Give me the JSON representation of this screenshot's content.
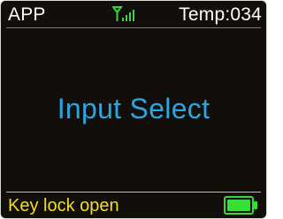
{
  "status_bar": {
    "app_label": "APP",
    "signal_icon": "signal-antenna-icon",
    "temperature_label": "Temp:034"
  },
  "main": {
    "title": "Input Select"
  },
  "footer": {
    "status_text": "Key lock open",
    "battery_icon": "battery-full-icon"
  },
  "colors": {
    "background": "#120e0a",
    "accent_blue": "#2aa6e4",
    "divider_blue": "#2c8fd0",
    "footer_yellow": "#f2dd2b",
    "battery_green": "#36e036"
  }
}
